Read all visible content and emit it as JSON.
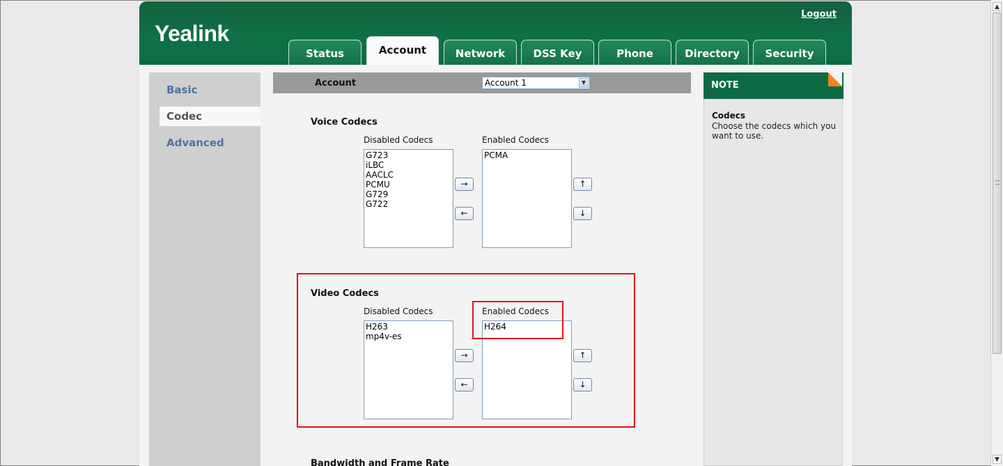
{
  "header": {
    "logo": "Yealink",
    "logout_label": "Logout"
  },
  "tabs": [
    {
      "label": "Status"
    },
    {
      "label": "Account"
    },
    {
      "label": "Network"
    },
    {
      "label": "DSS Key"
    },
    {
      "label": "Phone"
    },
    {
      "label": "Directory"
    },
    {
      "label": "Security"
    }
  ],
  "active_tab": "Account",
  "sidebar": {
    "items": [
      {
        "label": "Basic"
      },
      {
        "label": "Codec"
      },
      {
        "label": "Advanced"
      }
    ],
    "active": "Codec"
  },
  "account_bar": {
    "label": "Account",
    "selected": "Account 1"
  },
  "voice_codecs": {
    "title": "Voice Codecs",
    "disabled_label": "Disabled Codecs",
    "enabled_label": "Enabled Codecs",
    "disabled": [
      "G723",
      "iLBC",
      "AACLC",
      "PCMU",
      "G729",
      "G722"
    ],
    "enabled": [
      "PCMA"
    ]
  },
  "video_codecs": {
    "title": "Video Codecs",
    "disabled_label": "Disabled Codecs",
    "enabled_label": "Enabled Codecs",
    "disabled": [
      "H263",
      "mp4v-es"
    ],
    "enabled": [
      "H264"
    ]
  },
  "buttons": {
    "move_right": "→",
    "move_left": "←",
    "move_up": "↑",
    "move_down": "↓"
  },
  "next_section_title": "Bandwidth and Frame Rate",
  "note": {
    "header": "NOTE",
    "title": "Codecs",
    "text": "Choose the codecs which you want to use."
  },
  "colors": {
    "header_green": "#0d7047",
    "highlight_red": "#e0131b",
    "note_corner_orange": "#f58220"
  }
}
